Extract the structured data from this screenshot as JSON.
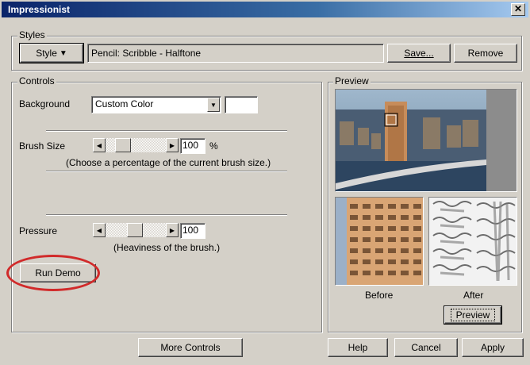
{
  "window": {
    "title": "Impressionist"
  },
  "styles": {
    "group_label": "Styles",
    "style_button": "Style",
    "current_style": "Pencil: Scribble - Halftone",
    "save_button": "Save...",
    "remove_button": "Remove"
  },
  "controls": {
    "group_label": "Controls",
    "background_label": "Background",
    "background_value": "Custom Color",
    "brush_size_label": "Brush Size",
    "brush_size_value": "100",
    "brush_size_unit": "%",
    "brush_size_hint": "(Choose a percentage of the current brush size.)",
    "pressure_label": "Pressure",
    "pressure_value": "100",
    "pressure_hint": "(Heaviness of the brush.)",
    "run_demo_button": "Run Demo"
  },
  "preview": {
    "group_label": "Preview",
    "before_label": "Before",
    "after_label": "After",
    "preview_button": "Preview"
  },
  "footer": {
    "more_controls_button": "More Controls",
    "help_button": "Help",
    "cancel_button": "Cancel",
    "apply_button": "Apply"
  },
  "colors": {
    "annotation_circle": "#d12a2a",
    "titlebar": "#0a246a"
  }
}
